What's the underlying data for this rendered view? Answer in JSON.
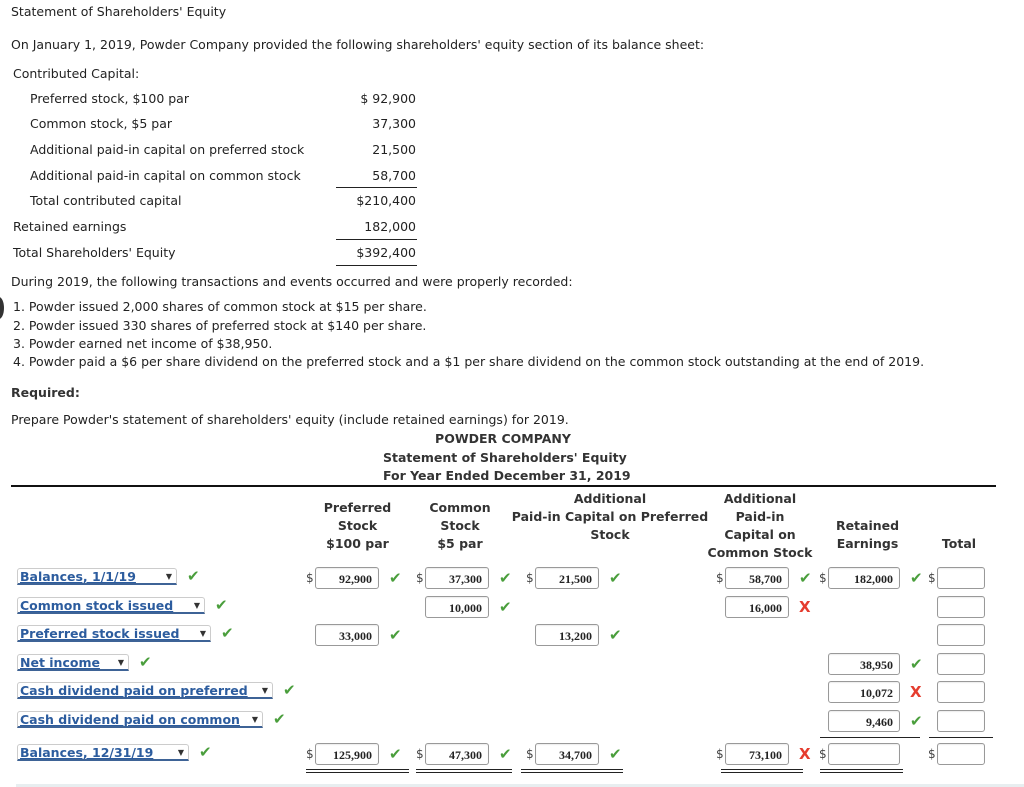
{
  "page_title": "Statement of Shareholders' Equity",
  "intro": "On January 1, 2019, Powder Company provided the following shareholders' equity section of its balance sheet:",
  "balance_sheet": {
    "heading": "Contributed Capital:",
    "rows": [
      {
        "label": "Preferred stock, $100 par",
        "amount": "$ 92,900"
      },
      {
        "label": "Common stock, $5 par",
        "amount": "37,300"
      },
      {
        "label": "Additional paid-in capital on preferred stock",
        "amount": "21,500"
      },
      {
        "label": "Additional paid-in capital on common stock",
        "amount": "58,700"
      },
      {
        "label": "Total contributed capital",
        "amount": "$210,400"
      },
      {
        "label": "Retained earnings",
        "amount": "182,000"
      },
      {
        "label": "Total Shareholders' Equity",
        "amount": "$392,400"
      }
    ]
  },
  "transactions_intro": "During 2019, the following transactions and events occurred and were properly recorded:",
  "transactions": [
    "1. Powder issued 2,000 shares of common stock at $15 per share.",
    "2. Powder issued 330 shares of preferred stock at $140 per share.",
    "3. Powder earned net income of $38,950.",
    "4. Powder paid a $6 per share dividend on the preferred stock and a $1 per share dividend on the common stock outstanding at the end of 2019."
  ],
  "required_label": "Required:",
  "required_text": "Prepare Powder's statement of shareholders' equity (include retained earnings) for 2019.",
  "statement": {
    "company": "POWDER COMPANY",
    "title": "Statement of Shareholders' Equity",
    "period": "For Year Ended December 31, 2019",
    "columns": [
      [
        "Preferred",
        "Stock",
        "$100 par"
      ],
      [
        "Common",
        "Stock",
        "$5 par"
      ],
      [
        "Additional",
        "Paid-in Capital on Preferred",
        "Stock"
      ],
      [
        "Additional",
        "Paid-in",
        "Capital on",
        "Common Stock"
      ],
      [
        "Retained",
        "Earnings"
      ],
      [
        "Total"
      ]
    ],
    "currency_symbol": "$",
    "rows": [
      {
        "label": "Balances, 1/1/19",
        "label_status": "correct",
        "cells": [
          {
            "value": "92,900",
            "status": "correct"
          },
          {
            "value": "37,300",
            "status": "correct"
          },
          {
            "value": "21,500",
            "status": "correct"
          },
          {
            "value": "58,700",
            "status": "correct"
          },
          {
            "value": "182,000",
            "status": "correct"
          },
          {
            "value": "",
            "status": ""
          }
        ]
      },
      {
        "label": "Common stock issued",
        "label_status": "correct",
        "cells": [
          null,
          {
            "value": "10,000",
            "status": "correct"
          },
          null,
          {
            "value": "16,000",
            "status": "incorrect"
          },
          null,
          {
            "value": "",
            "status": ""
          }
        ]
      },
      {
        "label": "Preferred stock issued",
        "label_status": "correct",
        "cells": [
          {
            "value": "33,000",
            "status": "correct"
          },
          null,
          {
            "value": "13,200",
            "status": "correct"
          },
          null,
          null,
          {
            "value": "",
            "status": ""
          }
        ]
      },
      {
        "label": "Net income",
        "label_status": "correct",
        "cells": [
          null,
          null,
          null,
          null,
          {
            "value": "38,950",
            "status": "correct"
          },
          {
            "value": "",
            "status": ""
          }
        ]
      },
      {
        "label": "Cash dividend paid on preferred",
        "label_status": "correct",
        "cells": [
          null,
          null,
          null,
          null,
          {
            "value": "10,072",
            "status": "incorrect"
          },
          {
            "value": "",
            "status": ""
          }
        ]
      },
      {
        "label": "Cash dividend paid on common",
        "label_status": "correct",
        "cells": [
          null,
          null,
          null,
          null,
          {
            "value": "9,460",
            "status": "correct"
          },
          {
            "value": "",
            "status": ""
          }
        ]
      },
      {
        "label": "Balances, 12/31/19",
        "label_status": "correct",
        "cells": [
          {
            "value": "125,900",
            "status": "correct"
          },
          {
            "value": "47,300",
            "status": "correct"
          },
          {
            "value": "34,700",
            "status": "correct"
          },
          {
            "value": "73,100",
            "status": "incorrect"
          },
          {
            "value": "",
            "status": ""
          },
          {
            "value": "",
            "status": ""
          }
        ]
      }
    ]
  },
  "status_icons": {
    "correct": "check-icon",
    "incorrect": "x-icon"
  },
  "colors": {
    "correct": "#4a9e3c",
    "incorrect": "#e53c2e",
    "link": "#2c5c9e"
  }
}
